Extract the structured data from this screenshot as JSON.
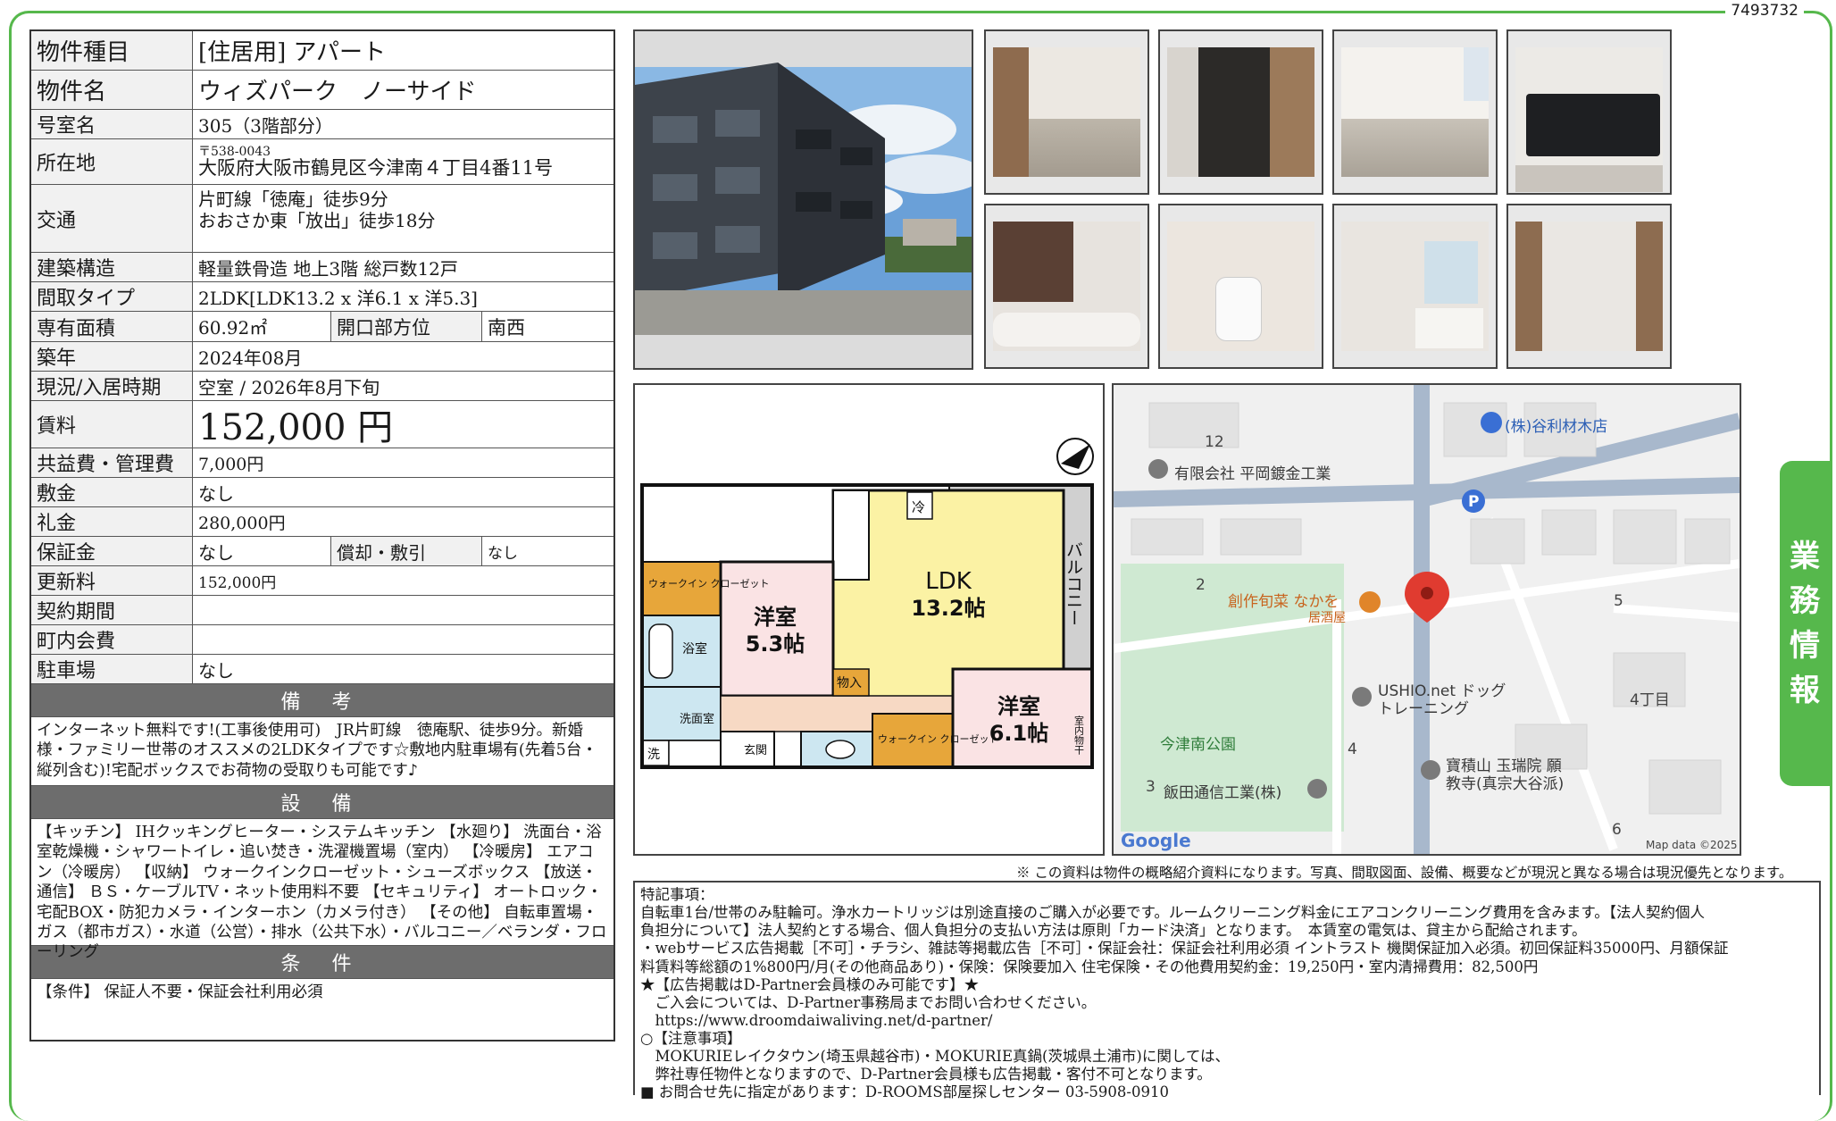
{
  "property_id": "7493732",
  "side_tab": [
    "業",
    "務",
    "情",
    "報"
  ],
  "rows": {
    "type": {
      "label": "物件種目",
      "value": "[住居用]  アパート"
    },
    "name": {
      "label": "物件名",
      "value": "ウィズパーク　ノーサイド"
    },
    "room": {
      "label": "号室名",
      "value": "305（3階部分）"
    },
    "address": {
      "label": "所在地",
      "postal": "〒538-0043",
      "value": "大阪府大阪市鶴見区今津南４丁目4番11号"
    },
    "access": {
      "label": "交通",
      "line1": "片町線「徳庵」徒歩9分",
      "line2": "おおさか東「放出」徒歩18分"
    },
    "structure": {
      "label": "建築構造",
      "value": "軽量鉄骨造 地上3階 総戸数12戸"
    },
    "layout": {
      "label": "間取タイプ",
      "value": "2LDK[LDK13.2 x 洋6.1 x 洋5.3]"
    },
    "area": {
      "label": "専有面積",
      "value": "60.92㎡",
      "label2": "開口部方位",
      "value2": "南西"
    },
    "built": {
      "label": "築年",
      "value": "2024年08月"
    },
    "status": {
      "label": "現況/入居時期",
      "value": "空室 / 2026年8月下旬"
    },
    "rent": {
      "label": "賃料",
      "value": "152,000 円"
    },
    "fee": {
      "label": "共益費・管理費",
      "value": "7,000円"
    },
    "deposit": {
      "label": "敷金",
      "value": "なし"
    },
    "key_money": {
      "label": "礼金",
      "value": "280,000円"
    },
    "guarantee": {
      "label": "保証金",
      "value": "なし",
      "label2": "償却・敷引",
      "value2": "なし"
    },
    "renewal": {
      "label": "更新料",
      "value": "152,000円"
    },
    "contract": {
      "label": "契約期間",
      "value": ""
    },
    "community": {
      "label": "町内会費",
      "value": ""
    },
    "parking": {
      "label": "駐車場",
      "value": "なし"
    }
  },
  "remarks": {
    "title": "備 考",
    "text": "インターネット無料です!(工事後使用可)　JR片町線　徳庵駅、徒歩9分。新婚様・ファミリー世帯のオススメの2LDKタイプです☆敷地内駐車場有(先着5台・縦列含む)!宅配ボックスでお荷物の受取りも可能です♪"
  },
  "equipment": {
    "title": "設 備",
    "text": "【キッチン】 IHクッキングヒーター・システムキッチン 【水廻り】 洗面台・浴室乾燥機・シャワートイレ・追い焚き・洗濯機置場（室内） 【冷暖房】 エアコン（冷暖房） 【収納】 ウォークインクローゼット・シューズボックス 【放送・通信】 ＢＳ・ケーブルTV・ネット使用料不要 【セキュリティ】 オートロック・宅配BOX・防犯カメラ・インターホン（カメラ付き） 【その他】 自転車置場・ガス（都市ガス）・水道（公営）・排水（公共下水）・バルコニー／ベランダ・フローリング"
  },
  "conditions": {
    "title": "条 件",
    "text": "【条件】 保証人不要・保証会社利用必須"
  },
  "floorplan": {
    "ldk": "LDK",
    "ldk_size": "13.2帖",
    "room1": "洋室",
    "room1_size": "5.3帖",
    "room2": "洋室",
    "room2_size": "6.1帖",
    "balcony": "バルコニー",
    "wic1": "ウォークイン\nクローゼット",
    "wic2": "ウォークイン\nクローゼット",
    "bath": "浴室",
    "washroom": "洗面室",
    "entrance": "玄関",
    "storage": "物入",
    "fridge": "冷",
    "laundry": "洗",
    "indoor_dry": "室内物干"
  },
  "map": {
    "poi_tanimoto": "(株)谷利材木店",
    "poi_hiraoka": "有限会社 平岡鍍金工業",
    "poi_restaurant": "創作旬菜 なかを",
    "poi_restaurant_sub": "居酒屋",
    "poi_ushio1": "USHIO.net ドッグ",
    "poi_ushio2": "トレーニング",
    "poi_park": "今津南公園",
    "poi_temple1": "寶積山 玉瑞院 願",
    "poi_temple2": "教寺(真宗大谷派)",
    "poi_iida": "飯田通信工業(株)",
    "chome": "4丁目",
    "block_12": "12",
    "block_2": "2",
    "block_5": "5",
    "block_4": "4",
    "block_3": "3",
    "block_6": "6",
    "parking_p": "P",
    "google": "Google",
    "map_data": "Map data ©2025"
  },
  "disclaimer": "※ この資料は物件の概略紹介資料になります。写真、間取図面、設備、概要などが現況と異なる場合は現況優先となります。",
  "special_notes": [
    "特記事項：",
    "自転車1台/世帯のみ駐輪可。浄水カートリッジは別途直接のご購入が必要です。ルームクリーニング料金にエアコンクリーニング費用を含みます。【法人契約個人",
    "負担分について】法人契約とする場合、個人負担分の支払い方法は原則「カード決済」となります。　本賃室の電気は、貸主から配給されます。",
    "・webサービス広告掲載［不可］・チラシ、雑誌等掲載広告［不可］・保証会社：保証会社利用必須 イントラスト 機関保証加入必須。初回保証料35000円、月額保証",
    "料賃料等総額の1%800円/月(その他商品あり)・保険：保険要加入 住宅保険・その他費用契約金：19,250円・室内清掃費用：82,500円",
    "★【広告掲載はD-Partner会員様のみ可能です】★",
    "　ご入会については、D-Partner事務局までお問い合わせください。",
    "　https://www.droomdaiwaliving.net/d-partner/",
    "○【注意事項】",
    "　MOKURIEレイクタウン(埼玉県越谷市)・MOKURIE真鍋(茨城県土浦市)に関しては、",
    "　弊社専任物件となりますので、D-Partner会員様も広告掲載・客付不可となります。",
    "■ お問合せ先に指定があります：D-ROOMS部屋探しセンター 03-5908-0910"
  ]
}
